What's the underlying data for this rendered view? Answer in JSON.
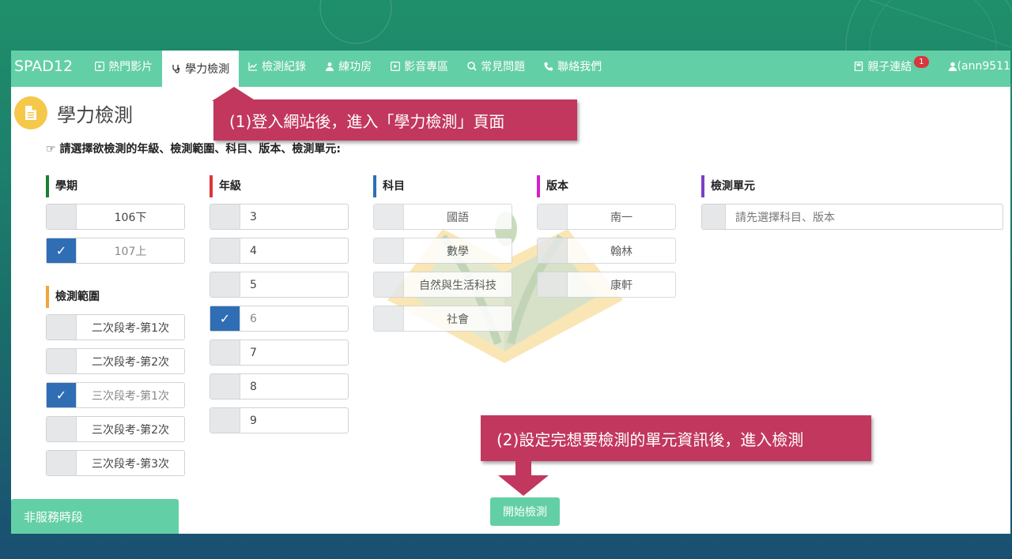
{
  "navbar": {
    "brand": "SPAD12",
    "items": [
      {
        "label": "熱門影片"
      },
      {
        "label": "學力檢測"
      },
      {
        "label": "檢測紀錄"
      },
      {
        "label": "練功房"
      },
      {
        "label": "影音專區"
      },
      {
        "label": "常見問題"
      },
      {
        "label": "聯絡我們"
      }
    ],
    "parent_link": "親子連結",
    "parent_badge": "1",
    "user": "(ann9511"
  },
  "page": {
    "title": "學力檢測",
    "instruction": "請選擇欲檢測的年級、檢測範圍、科目、版本、檢測單元:"
  },
  "semester": {
    "title": "學期",
    "options": [
      {
        "label": "106下",
        "checked": false
      },
      {
        "label": "107上",
        "checked": true
      }
    ]
  },
  "scope": {
    "title": "檢測範圍",
    "options": [
      {
        "label": "二次段考-第1次",
        "checked": false
      },
      {
        "label": "二次段考-第2次",
        "checked": false
      },
      {
        "label": "三次段考-第1次",
        "checked": true
      },
      {
        "label": "三次段考-第2次",
        "checked": false
      },
      {
        "label": "三次段考-第3次",
        "checked": false
      }
    ]
  },
  "grade": {
    "title": "年級",
    "options": [
      {
        "label": "3",
        "checked": false
      },
      {
        "label": "4",
        "checked": false
      },
      {
        "label": "5",
        "checked": false
      },
      {
        "label": "6",
        "checked": true
      },
      {
        "label": "7",
        "checked": false
      },
      {
        "label": "8",
        "checked": false
      },
      {
        "label": "9",
        "checked": false
      }
    ]
  },
  "subject": {
    "title": "科目",
    "options": [
      {
        "label": "國語"
      },
      {
        "label": "數學"
      },
      {
        "label": "自然與生活科技"
      },
      {
        "label": "社會"
      }
    ]
  },
  "edition": {
    "title": "版本",
    "options": [
      {
        "label": "南一"
      },
      {
        "label": "翰林"
      },
      {
        "label": "康軒"
      }
    ]
  },
  "unit": {
    "title": "檢測單元",
    "placeholder": "請先選擇科目、版本"
  },
  "start_button": "開始檢測",
  "status": "非服務時段",
  "callouts": {
    "step1": "(1)登入網站後，進入「學力檢測」頁面",
    "step2": "(2)設定完想要檢測的單元資訊後，進入檢測"
  },
  "colors": {
    "nav": "#63cfa6",
    "callout": "#c2375d",
    "checked": "#2f6eb5",
    "semester_bar": "#1a7f32",
    "grade_bar": "#d9363e",
    "subject_bar": "#2f6eb5",
    "edition_bar": "#d01fd0",
    "unit_bar": "#7b3fc4",
    "scope_bar": "#f0a63a"
  }
}
